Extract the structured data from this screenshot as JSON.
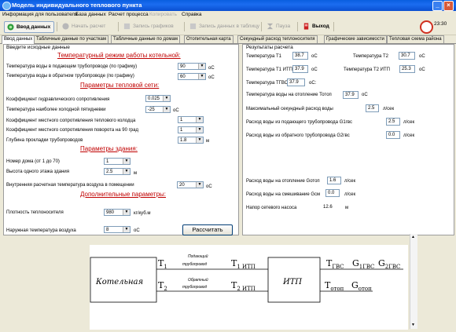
{
  "window": {
    "title": "Модель индивидуального теплового пункта"
  },
  "menu": {
    "items": [
      "Информация для пользователя",
      "База данных",
      "Расчет процесса",
      "Копировать",
      "Справка"
    ]
  },
  "toolbar": {
    "input_data": "Ввод данных",
    "start_calc": "Начать расчет",
    "save_graphs": "Запись графиков",
    "save_table": "Запись данных в таблицу",
    "pause": "Пауза",
    "exit": "Выход",
    "clock": "23:30"
  },
  "tabs": [
    "Ввод данных",
    "Табличные данные по участкам",
    "Табличные данные по домам",
    "Отопительная карта",
    "Секундный расход теплоносителя",
    "Графические зависимости",
    "Тепловая схема района"
  ],
  "input": {
    "header": "Введите исходные данные",
    "sections": {
      "temp_mode": "Температурный режим работы котельной:",
      "heat_net": "Параметры тепловой сети:",
      "building": "Параметры здания:",
      "extra": "Дополнительные параметры:"
    },
    "fields": {
      "supply_temp": {
        "label": "Температура воды в подающем трубопроводе (по графику)",
        "value": "90",
        "unit": "oC"
      },
      "return_temp": {
        "label": "Температура воды в обратном трубопроводе (по графику)",
        "value": "60",
        "unit": "oC"
      },
      "hydr_coef": {
        "label": "Коэффициент гидравлического сопротивления",
        "value": "0.025"
      },
      "cold_5day": {
        "label": "Температура наиболее холодной пятидневки",
        "value": "-25",
        "unit": "oC"
      },
      "local_res_well": {
        "label": "Коэффициент местного сопротивления теплового колодца",
        "value": "1"
      },
      "local_res_turn": {
        "label": "Коэффициент местного сопротивления поворота на 90 град",
        "value": "1"
      },
      "depth": {
        "label": "Глубина прокладки трубопроводов",
        "value": "1.8",
        "unit": "м"
      },
      "house_no": {
        "label": "Номер дома (от 1 до 70)",
        "value": "1"
      },
      "floor_height": {
        "label": "Высота одного этажа здания",
        "value": "2.5",
        "unit": "м"
      },
      "inner_temp": {
        "label": "Внутренняя расчетная температура воздуха в помещении",
        "value": "20",
        "unit": "oC"
      },
      "density": {
        "label": "Плотность теплоносителя",
        "value": "980",
        "unit": "кг/куб.м"
      },
      "outer_temp": {
        "label": "Наружная температура воздуха",
        "value": "8",
        "unit": "oC"
      }
    },
    "calc_button": "Рассчитать"
  },
  "results": {
    "header": "Результаты расчета",
    "t1": {
      "label": "Температура Т1",
      "value": "38.7",
      "unit": "oC"
    },
    "t2": {
      "label": "Температура Т2",
      "value": "30.7",
      "unit": "oC"
    },
    "t1itp": {
      "label": "Температура Т1 ИТП",
      "value": "37.9",
      "unit": "oC"
    },
    "t2itp": {
      "label": "Температура Т2 ИТП",
      "value": "25.3",
      "unit": "oC"
    },
    "tgvs": {
      "label": "Температура ТГВС",
      "value": "37.9",
      "unit": "oC:"
    },
    "totop": {
      "label": "Температура воды на отопление Тотоп",
      "value": "37.9",
      "unit": "oC"
    },
    "max_flow": {
      "label": "Максимальный секундный расход воды",
      "value": "2.5",
      "unit": "л/сек"
    },
    "g1": {
      "label": "Расход воды из подающего трубопровода G1гвс",
      "value": "2.5",
      "unit": "л/сек"
    },
    "g2": {
      "label": "Расход воды из обратного трубопровода G2гвс",
      "value": "0.0",
      "unit": "л/сек"
    },
    "gotop": {
      "label": "Расход воды на отопление Gотоп",
      "value": "1.6",
      "unit": "л/сек"
    },
    "gsm": {
      "label": "Расход воды на смешивание Gсм",
      "value": "0.0",
      "unit": "л/сек"
    },
    "head": {
      "label": "Напор сетевого насоса",
      "value": "12.6",
      "unit": "м"
    }
  },
  "diagram": {
    "boiler": "Котельная",
    "itp": "ИТП",
    "t1": "T",
    "t1_sub": "1",
    "t2": "T",
    "t2_sub": "2",
    "supply_pipe_1": "Подающий",
    "supply_pipe_2": "трубопровод",
    "return_pipe_1": "Обратный",
    "return_pipe_2": "трубопровод",
    "t1_itp": "T",
    "t1_itp_sub": "1 ИТП",
    "t2_itp": "T",
    "t2_itp_sub": "2 ИТП",
    "tgvs": "T",
    "tgvs_sub": "ГВС",
    "g1gvs": "G",
    "g1gvs_sub": "1ГВС",
    "g2gvs": "G",
    "g2gvs_sub": "2ГВС",
    "totop": "T",
    "totop_sub": "отоп",
    "gotop": "G",
    "gotop_sub": "отоп"
  }
}
